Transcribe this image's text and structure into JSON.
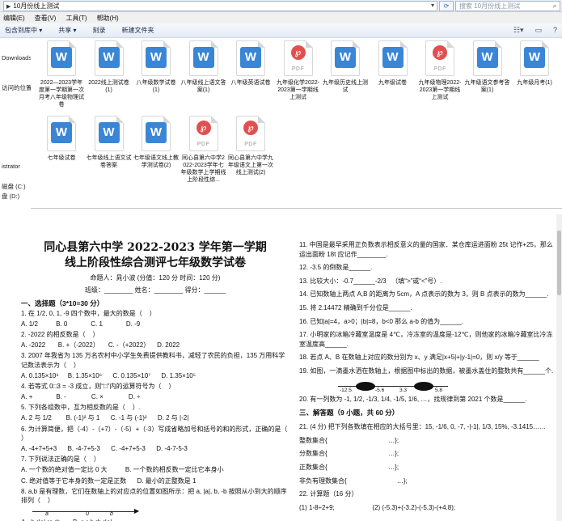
{
  "explorer": {
    "address": "10月份线上测试",
    "search_placeholder": "搜索 10月份线上测试",
    "menu": [
      "编辑(E)",
      "查看(V)",
      "工具(T)",
      "帮助(H)"
    ],
    "toolbar": [
      "包含到库中 ▾",
      "共享 ▾",
      "刻录",
      "新建文件夹"
    ],
    "nav": [
      "Downloads",
      "访问的位置",
      "istrator",
      "磁盘 (C:)",
      "盘 (D:)"
    ],
    "files": [
      {
        "type": "word",
        "label": "2022—2023学年度第一学期第一次月考八年级物理试卷"
      },
      {
        "type": "word",
        "label": "2022线上测试卷(1)"
      },
      {
        "type": "word",
        "label": "八年级数学试卷(1)"
      },
      {
        "type": "word",
        "label": "八年级线上语文答案(1)"
      },
      {
        "type": "word",
        "label": "八年级英语试卷"
      },
      {
        "type": "pdf",
        "label": "九年级化学2022-2023第一学期线上测试"
      },
      {
        "type": "word",
        "label": "九年级历史线上测试"
      },
      {
        "type": "word",
        "label": "九年级试卷"
      },
      {
        "type": "pdf",
        "label": "九年级物理2022-2023第一学期线上测试"
      },
      {
        "type": "word",
        "label": "九年级语文参考答案(1)"
      },
      {
        "type": "word",
        "label": "九年级月考(1)"
      },
      {
        "type": "word",
        "label": "七年级试卷"
      },
      {
        "type": "word",
        "label": "七年级线上语文试卷答案"
      },
      {
        "type": "word",
        "label": "七年级语文线上教学测试卷(2)"
      },
      {
        "type": "pdf",
        "label": "同心县第六中学2022-2023学年七年级数学上学期线上阶段性综..."
      },
      {
        "type": "pdf",
        "label": "同心县第六中学九年级语文上第一次线上测试(2)"
      }
    ]
  },
  "paper": {
    "title_line1": "同心县第六中学 2022-2023 学年第一学期",
    "title_line2": "线上阶段性综合测评七年级数学试卷",
    "meta_line1": "命题人：晁小波    (分值：120 分   时间：120 分)",
    "meta_line2": "班级：________   姓名：________   得分：______",
    "section1": "一、选择题（3*10=30 分）",
    "left_questions": [
      "1. 在 1/2, 0, 1, -9 四个数中，最大的数是（    ）",
      "A. 1/2          B. 0             C. 1             D. -9",
      "2. -2022 的相反数是（    ）",
      "A. -2022       B. +（-2022）     C. -（+2022）    D. 2022",
      "3. 2007 年我省为 135 万名农村中小学生免费提供教科书，减轻了农民的负担，135 万用科学记数法表示为（    ）",
      "A. 0.135×10⁶     B. 1.35×10⁶      C. 0.135×10⁷      D. 1.35×10⁵",
      "4. 若等式 0□3 = -3 成立，则“□”内的运算符号为（    ）",
      "A. +             B. -              C. ×              D. ÷",
      "5. 下列各组数中，互为相反数的是（    ）.",
      "A. 2 与 1/2        B. (-1)² 与 1      C. -1 与 (-1)²      D. 2 与 |-2|",
      "6. 为计算简便，把（-4）-（+7）-（-5）+（-3）写成省略加号和括号的和的形式，正确的是（    ）",
      "A. -4+7+5+3      B. -4-7+5-3      C. -4+7+5-3      D. -4-7-5-3",
      "7. 下列说法正确的是（    ）",
      "A. 一个数的绝对值一定比 0 大          B. 一个数的相反数一定比它本身小",
      "C. 绝对值等于它本身的数一定是正数      D. 最小的正整数是 1",
      "8. a,b 是有理数，它们在数轴上的对应点的位置如图所示：把 a, |a|, b, -b 按照从小到大的顺序排列（    ）"
    ],
    "numline_labels": [
      "a",
      "0",
      "b"
    ],
    "left_questions2": [
      "A. -b<|a|<a<b       B. a<-b<b<|a|",
      "C. -b<a<|a|<b       D. a<|a|<-b<b"
    ],
    "right_questions": [
      "11. 中国是最早采用正负数表示相反意义的量的国家．某仓库运进面粉 25t 记作+25，那么运出面粉 18t 应记作________.",
      "12. -3.5 的倒数是______.",
      "13. 比较大小：-0.7______-2/3   （填“>”或“<”号）.",
      "14. 已知数轴上两点 A,B 的距离为 5cm，A 点表示的数为 3，则 B 点表示的数为______.",
      "15. 将 2.14472 精确到千分位是______.",
      "16. 已知|a|=4，a>0；|b|=8，b<0 那么 a-b 的值为______.",
      "17. 小明家的冰箱冷藏室温度是 4℃，冷冻室的温度是-12℃，则他家的冰箱冷藏室比冷冻室温度高______.",
      "18. 若点 A、B 在数轴上对应的数分别为 x、y 满足|x+5|+|y-1|=0，则 x/y 等于______",
      "19. 如图，一滴墨水洒在数轴上，根据图中标出的数据，被墨水盖住的整数共有______个."
    ],
    "thermo_ticks": [
      "-12.5",
      "-5.6",
      "3.3",
      "5.8"
    ],
    "right_questions2": [
      "20. 有一列数为 -1, 1/2, -1/3, 1/4, -1/5, 1/6, …，找规律到第 2021 个数是______.",
      "三、解答题（9 小题，共 60 分）",
      "21. (4 分) 把下列各数填在相应的大括号里：15, -1/6, 0, -7, -|-1|, 1/3, 15%, -3.1415……",
      "整数集合{                                  …};",
      "分数集合{                                  …};",
      "正数集合{                                  …};",
      "非负有理数集合{                            …};",
      "22. 计算题（16 分）",
      "(1) 1-8÷2+9;                     (2) (-5.3)+(-3.2)-(-5.3)-(+4.8);"
    ]
  }
}
